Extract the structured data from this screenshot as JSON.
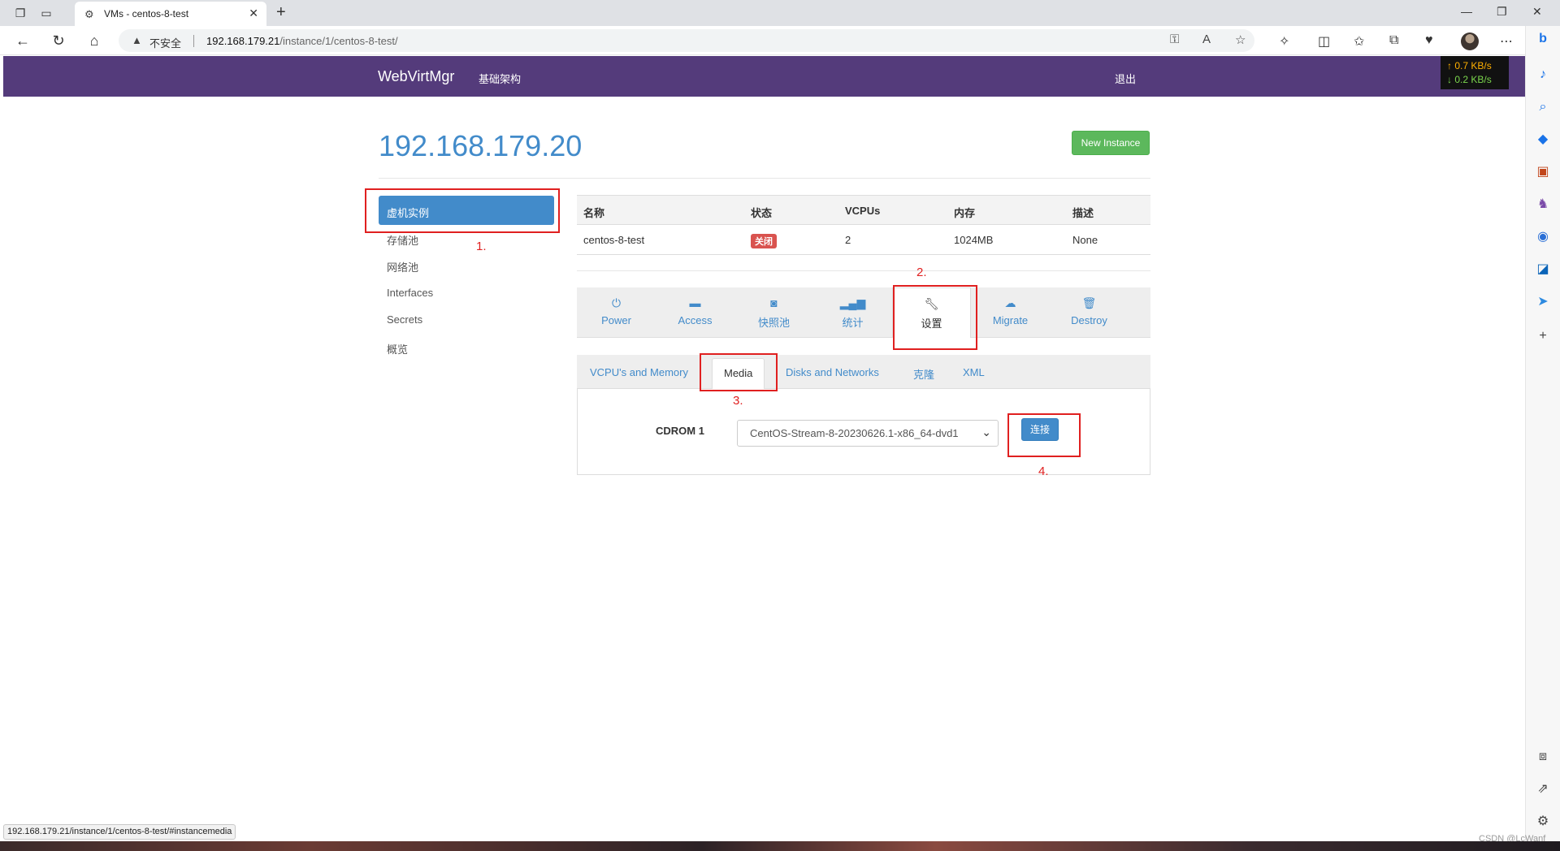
{
  "browser": {
    "tab_title": "VMs - centos-8-test",
    "security_label": "不安全",
    "url_host": "192.168.179.21",
    "url_path": "/instance/1/centos-8-test/",
    "net_up": "↑ 0.7 KB/s",
    "net_down": "↓ 0.2 KB/s",
    "status_url": "192.168.179.21/instance/1/centos-8-test/#instancemedia",
    "watermark": "CSDN @LcWanf"
  },
  "navbar": {
    "brand": "WebVirtMgr",
    "infrastructure": "基础架构",
    "logout": "退出",
    "color": "#543b7b"
  },
  "page": {
    "host_title": "192.168.179.20",
    "new_instance_label": "New Instance"
  },
  "sidebar": {
    "items": [
      {
        "label": "虚机实例",
        "active": true
      },
      {
        "label": "存储池"
      },
      {
        "label": "网络池"
      },
      {
        "label": "Interfaces"
      },
      {
        "label": "Secrets"
      },
      {
        "label": "概览"
      }
    ]
  },
  "table": {
    "headers": [
      "名称",
      "状态",
      "VCPUs",
      "内存",
      "描述"
    ],
    "row": {
      "name": "centos-8-test",
      "status": "关闭",
      "vcpus": "2",
      "memory": "1024MB",
      "description": "None"
    }
  },
  "actions": [
    {
      "label": "Power",
      "icon": "power-icon"
    },
    {
      "label": "Access",
      "icon": "briefcase-icon"
    },
    {
      "label": "快照池",
      "icon": "camera-icon"
    },
    {
      "label": "统计",
      "icon": "signal-icon"
    },
    {
      "label": "设置",
      "icon": "wrench-icon",
      "active": true
    },
    {
      "label": "Migrate",
      "icon": "cloud-upload-icon"
    },
    {
      "label": "Destroy",
      "icon": "trash-icon"
    }
  ],
  "subtabs": [
    {
      "label": "VCPU's and Memory"
    },
    {
      "label": "Media",
      "active": true
    },
    {
      "label": "Disks and Networks"
    },
    {
      "label": "克隆"
    },
    {
      "label": "XML"
    }
  ],
  "media": {
    "cdrom_label": "CDROM 1",
    "selected_iso": "CentOS-Stream-8-20230626.1-x86_64-dvd1",
    "connect_label": "连接"
  },
  "annotations": [
    "1.",
    "2.",
    "3.",
    "4."
  ]
}
